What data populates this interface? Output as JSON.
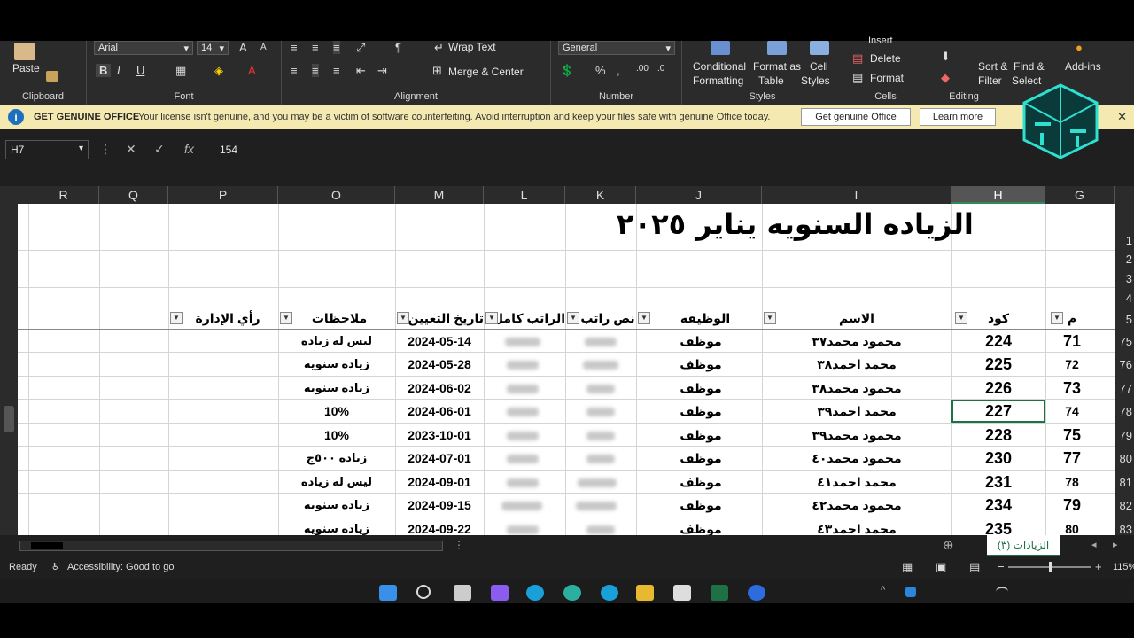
{
  "ribbon": {
    "paste": "Paste",
    "clipboard": "Clipboard",
    "font_name": "Arial",
    "font_size": "14",
    "font": "Font",
    "wrap_text": "Wrap Text",
    "merge_center": "Merge & Center",
    "alignment": "Alignment",
    "number_format": "General",
    "number": "Number",
    "cond_format": "Conditional",
    "cond_format2": "Formatting",
    "format_table": "Format as",
    "format_table2": "Table",
    "cell_styles": "Cell",
    "cell_styles2": "Styles",
    "styles": "Styles",
    "insert": "Insert",
    "delete": "Delete",
    "format": "Format",
    "cells": "Cells",
    "sort": "Sort &",
    "sort2": "Filter",
    "find": "Find &",
    "find2": "Select",
    "editing": "Editing",
    "addins": "Add-ins"
  },
  "license": {
    "title": "GET GENUINE OFFICE",
    "text": "Your license isn't genuine, and you may be a victim of software counterfeiting. Avoid interruption and keep your files safe with genuine Office today.",
    "button1": "Get genuine Office",
    "button2": "Learn more"
  },
  "formula": {
    "cell_ref": "H7",
    "value": "154"
  },
  "columns": [
    "R",
    "Q",
    "P",
    "O",
    "M",
    "L",
    "K",
    "J",
    "I",
    "H",
    "G"
  ],
  "sheet_title": "الزياده السنويه يناير ٢٠٢٥",
  "headers": {
    "m": "م",
    "code": "كود",
    "name": "الاسم",
    "job": "الوظيفه",
    "salary_text": "نص راتب",
    "full_salary": "الراتب كامل",
    "hire_date": "تاريخ التعيين",
    "notes": "ملاحظات",
    "management": "رأي الإدارة"
  },
  "rows": [
    {
      "row": "75",
      "m": "71",
      "code": "224",
      "name": "محمود محمد٣٧",
      "job": "موظف",
      "date": "2024-05-14",
      "note": "ليس له زياده"
    },
    {
      "row": "76",
      "m": "72",
      "code": "225",
      "name": "محمد احمد٣٨",
      "job": "موظف",
      "date": "2024-05-28",
      "note": "زياده سنويه"
    },
    {
      "row": "77",
      "m": "73",
      "code": "226",
      "name": "محمود محمد٣٨",
      "job": "موظف",
      "date": "2024-06-02",
      "note": "زياده سنويه"
    },
    {
      "row": "78",
      "m": "74",
      "code": "227",
      "name": "محمد احمد٣٩",
      "job": "موظف",
      "date": "2024-06-01",
      "note": "10%"
    },
    {
      "row": "79",
      "m": "75",
      "code": "228",
      "name": "محمود محمد٣٩",
      "job": "موظف",
      "date": "2023-10-01",
      "note": "10%"
    },
    {
      "row": "80",
      "m": "77",
      "code": "230",
      "name": "محمود محمد٤٠",
      "job": "موظف",
      "date": "2024-07-01",
      "note": "زياده ٥٠٠ج"
    },
    {
      "row": "81",
      "m": "78",
      "code": "231",
      "name": "محمد احمد٤١",
      "job": "موظف",
      "date": "2024-09-01",
      "note": "ليس له زياده"
    },
    {
      "row": "82",
      "m": "79",
      "code": "234",
      "name": "محمود محمد٤٢",
      "job": "موظف",
      "date": "2024-09-15",
      "note": "زياده سنويه"
    },
    {
      "row": "83",
      "m": "80",
      "code": "235",
      "name": "محمد احمد٤٣",
      "job": "موظف",
      "date": "2024-09-22",
      "note": "زياده سنويه"
    }
  ],
  "top_rows": [
    "1",
    "2",
    "3",
    "4",
    "5"
  ],
  "sheet_tab": "الزيادات (٣)",
  "status": {
    "ready": "Ready",
    "accessibility": "Accessibility: Good to go",
    "zoom": "115%"
  },
  "colors": {
    "accent": "#1e7145",
    "ribbon_bg": "#2b2b2b",
    "license_bg": "#f4e9b0"
  }
}
